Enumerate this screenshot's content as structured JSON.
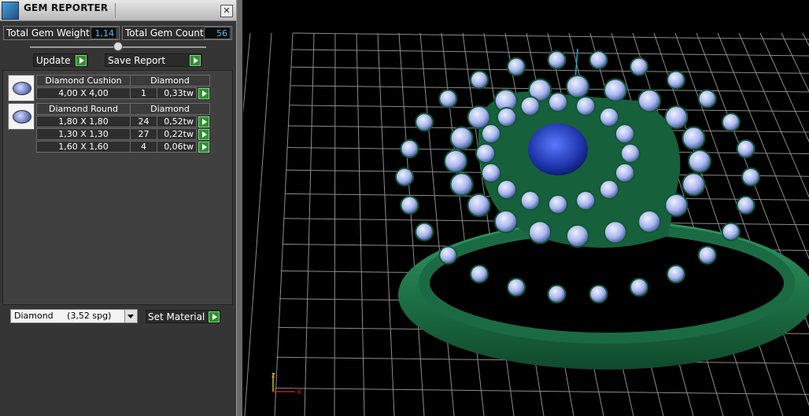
{
  "window": {
    "title": "GEM REPORTER",
    "close_glyph": "✕"
  },
  "summary": {
    "total_weight_label": "Total Gem Weight",
    "total_weight_value": "1,14",
    "total_count_label": "Total Gem Count",
    "total_count_value": "56"
  },
  "toolbar": {
    "update_label": "Update",
    "save_report_label": "Save Report"
  },
  "gem_groups": [
    {
      "name": "Diamond Cushion",
      "material": "Diamond",
      "rows": [
        {
          "size": "4,00 X 4,00",
          "count": "1",
          "weight": "0,33tw"
        }
      ]
    },
    {
      "name": "Diamond Round",
      "material": "Diamond",
      "rows": [
        {
          "size": "1,80 X 1,80",
          "count": "24",
          "weight": "0,52tw"
        },
        {
          "size": "1,30 X 1,30",
          "count": "27",
          "weight": "0,22tw"
        },
        {
          "size": "1,60 X 1,60",
          "count": "4",
          "weight": "0,06tw"
        }
      ]
    }
  ],
  "material": {
    "selected": "Diamond     (3,52 spg)",
    "set_material_label": "Set Material"
  },
  "viewport": {
    "axis_x_label": "x",
    "axis_z_label": "z",
    "colors": {
      "metal": "#1f7a4f",
      "stone_center": "#2340b8",
      "stones": "#b9c3f0",
      "grid": "#9a9a9a",
      "x_axis": "#c02020",
      "y_axis": "#2aa8c8"
    }
  },
  "icons": {
    "app": "gem-reporter-app-icon",
    "play": "play-icon",
    "gem_thumb": "gem-thumbnail-icon"
  }
}
